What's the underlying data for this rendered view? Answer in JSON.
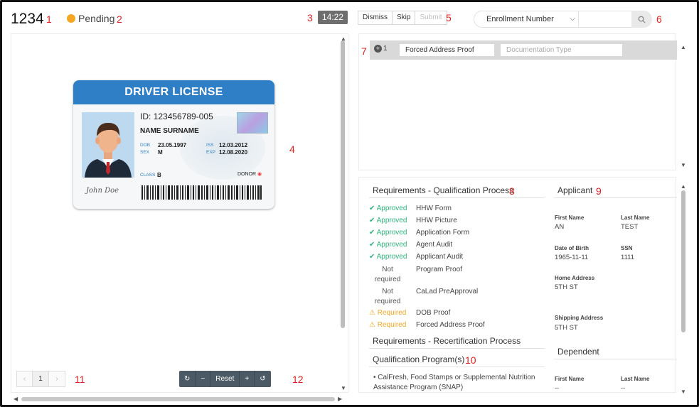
{
  "header": {
    "case_id": "1234",
    "status": "Pending",
    "status_color": "#f5a623",
    "timer": "14:22",
    "buttons": {
      "dismiss": "Dismiss",
      "skip": "Skip",
      "submit": "Submit"
    },
    "search_type": "Enrollment Number",
    "search_value": ""
  },
  "annotations": [
    "1",
    "2",
    "3",
    "4",
    "5",
    "6",
    "7",
    "8",
    "9",
    "10",
    "11",
    "12"
  ],
  "license": {
    "title": "DRIVER LICENSE",
    "id": "ID: 123456789-005",
    "name": "NAME SURNAME",
    "dob_label": "DOB",
    "dob": "23.05.1997",
    "iss_label": "ISS",
    "iss": "12.03.2012",
    "sex_label": "SEX",
    "sex": "M",
    "exp_label": "EXP",
    "exp": "12.08.2020",
    "class_label": "CLASS",
    "class": "B",
    "donor": "DONOR",
    "signature": "John Doe",
    "brand_color": "#2f7fc7"
  },
  "viewer": {
    "page": "1",
    "prev": "‹",
    "next": "›",
    "tools": {
      "rotate_right": "↻",
      "zoom_out": "−",
      "reset": "Reset",
      "zoom_in": "+",
      "rotate_left": "↺"
    }
  },
  "documents": [
    {
      "index": "1",
      "name": "Forced Address Proof",
      "type_placeholder": "Documentation Type"
    }
  ],
  "requirements": {
    "title": "Requirements - Qualification Process",
    "items": [
      {
        "status": "Approved",
        "name": "HHW Form"
      },
      {
        "status": "Approved",
        "name": "HHW Picture"
      },
      {
        "status": "Approved",
        "name": "Application Form"
      },
      {
        "status": "Approved",
        "name": "Agent Audit"
      },
      {
        "status": "Approved",
        "name": "Applicant Audit"
      },
      {
        "status": "Not required",
        "name": "Program Proof"
      },
      {
        "status": "Not required",
        "name": "CaLad PreApproval"
      },
      {
        "status": "Required",
        "name": "DOB Proof"
      },
      {
        "status": "Required",
        "name": "Forced Address Proof"
      }
    ],
    "recert_title": "Requirements - Recertification Process",
    "programs_title": "Qualification Program(s)",
    "program": "CalFresh, Food Stamps or Supplemental Nutrition Assistance Program (SNAP)",
    "approved_color": "#2db57a",
    "required_color": "#f5a623"
  },
  "applicant": {
    "title": "Applicant",
    "first_name_label": "First Name",
    "first_name": "AN",
    "last_name_label": "Last Name",
    "last_name": "TEST",
    "dob_label": "Date of Birth",
    "dob": "1965-11-11",
    "ssn_label": "SSN",
    "ssn": "1111",
    "home_label": "Home Address",
    "home": "5TH ST",
    "shipping_label": "Shipping Address",
    "shipping": "5TH ST"
  },
  "dependent": {
    "title": "Dependent",
    "first_name_label": "First Name",
    "first_name": "--",
    "last_name_label": "Last Name",
    "last_name": "--"
  }
}
